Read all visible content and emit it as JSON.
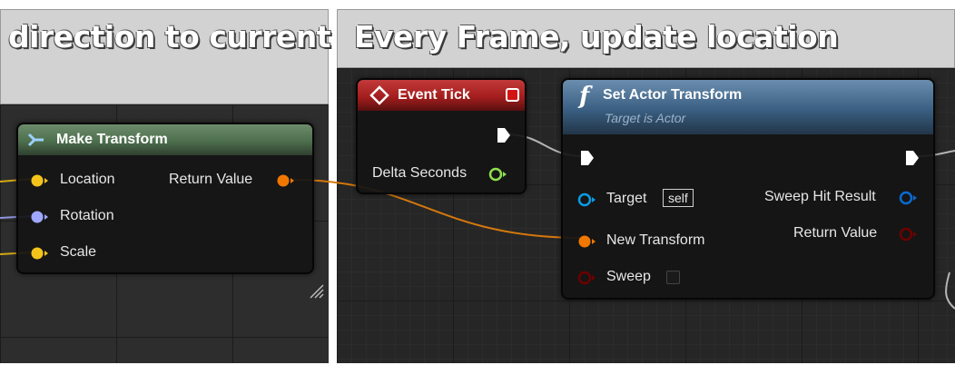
{
  "comments": {
    "left_title": "direction to current",
    "right_title": "Every Frame, update location"
  },
  "make_transform": {
    "title": "Make Transform",
    "pins": {
      "location": "Location",
      "rotation": "Rotation",
      "scale": "Scale",
      "return_value": "Return Value"
    }
  },
  "event_tick": {
    "title": "Event Tick",
    "delta_seconds": "Delta Seconds"
  },
  "set_actor_transform": {
    "title": "Set Actor Transform",
    "subtitle": "Target is Actor",
    "function_glyph": "f",
    "pins": {
      "target": "Target",
      "target_default": "self",
      "new_transform": "New Transform",
      "sweep": "Sweep",
      "sweep_hit_result": "Sweep Hit Result",
      "return_value": "Return Value"
    }
  },
  "colors": {
    "transform_pin": "#f07800",
    "vector_pin": "#f4c41a",
    "rotator_pin": "#9fa8ff",
    "float_pin": "#8fe04c",
    "object_pin": "#0a9ce6",
    "struct_pin": "#0a6ad0",
    "bool_pin": "#6e0000",
    "event_header": "#a51e1e",
    "function_header": "#3a5f82",
    "pure_header": "#4d6f4d"
  }
}
